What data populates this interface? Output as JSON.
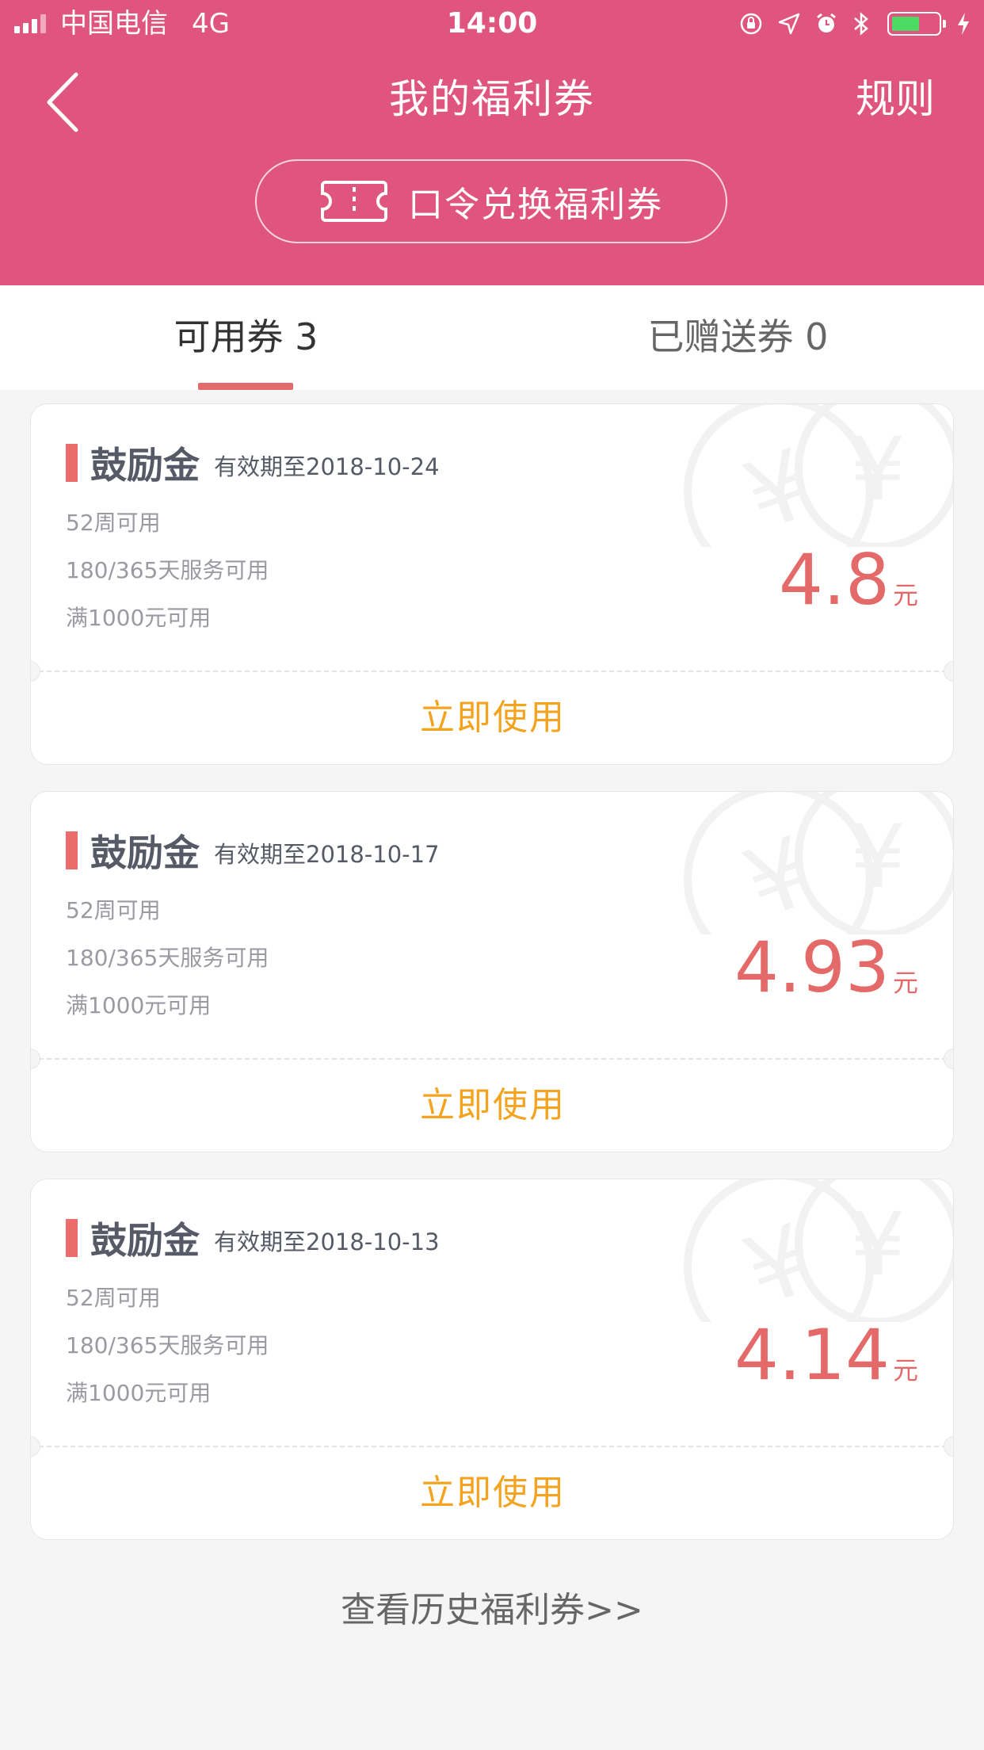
{
  "status_bar": {
    "carrier": "中国电信",
    "network": "4G",
    "time": "14:00"
  },
  "nav": {
    "title": "我的福利券",
    "rules_label": "规则"
  },
  "redeem": {
    "label": "口令兑换福利券"
  },
  "tabs": [
    {
      "label": "可用券 3"
    },
    {
      "label": "已赠送券 0"
    }
  ],
  "coupons": [
    {
      "name": "鼓励金",
      "expiry": "有效期至2018-10-24",
      "conditions": [
        "52周可用",
        "180/365天服务可用",
        "满1000元可用"
      ],
      "amount": "4.8",
      "unit": "元",
      "action_label": "立即使用"
    },
    {
      "name": "鼓励金",
      "expiry": "有效期至2018-10-17",
      "conditions": [
        "52周可用",
        "180/365天服务可用",
        "满1000元可用"
      ],
      "amount": "4.93",
      "unit": "元",
      "action_label": "立即使用"
    },
    {
      "name": "鼓励金",
      "expiry": "有效期至2018-10-13",
      "conditions": [
        "52周可用",
        "180/365天服务可用",
        "满1000元可用"
      ],
      "amount": "4.14",
      "unit": "元",
      "action_label": "立即使用"
    }
  ],
  "history_link": "查看历史福利券>>",
  "colors": {
    "header": "#df5580",
    "tab_indicator": "#e26a6a",
    "amount": "#e46a6a",
    "action": "#f3a31d",
    "background": "#f5f5f6"
  },
  "icons": {
    "back": "chevron-left-icon",
    "ticket": "ticket-icon",
    "coin": "yuan-coin-icon"
  }
}
